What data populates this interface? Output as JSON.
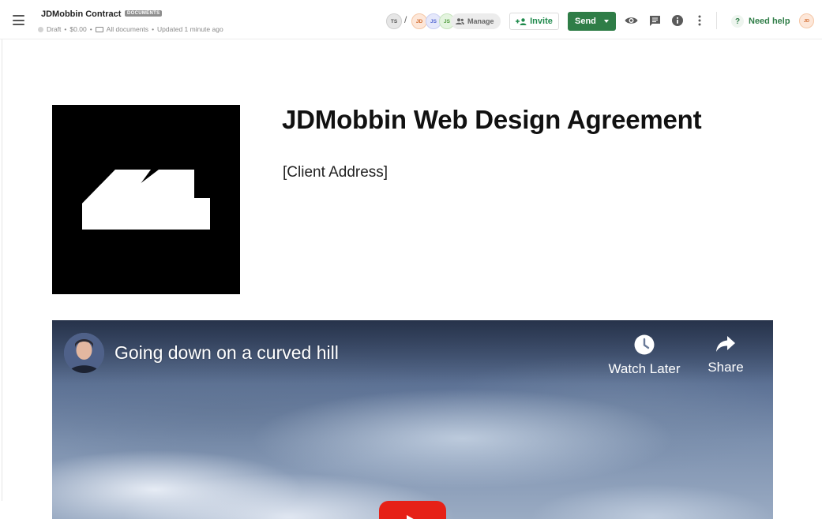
{
  "header": {
    "doc_title": "JDMobbin Contract",
    "doc_badge": "DOCUMENTS",
    "status": "Draft",
    "amount": "$0.00",
    "folder": "All documents",
    "updated": "Updated 1 minute ago"
  },
  "collaborators": {
    "owner_initials": "TS",
    "separator": "/",
    "members": [
      "JD",
      "JS",
      "JS"
    ],
    "manage_label": "Manage"
  },
  "actions": {
    "invite_label": "Invite",
    "send_label": "Send",
    "help_label": "Need help",
    "help_glyph": "?",
    "user_initials": "JD"
  },
  "icons": {
    "menu": "hamburger-menu-icon",
    "preview": "eye-icon",
    "comments": "comment-icon",
    "info": "info-icon",
    "more": "more-vertical-icon"
  },
  "document": {
    "title": "JDMobbin Web Design Agreement",
    "client_address": "[Client Address]"
  },
  "video": {
    "title": "Going down on a curved hill",
    "watch_later_label": "Watch Later",
    "share_label": "Share"
  },
  "colors": {
    "brand_green": "#2f7d47",
    "invite_green": "#1f8a4c",
    "youtube_red": "#e62117"
  }
}
